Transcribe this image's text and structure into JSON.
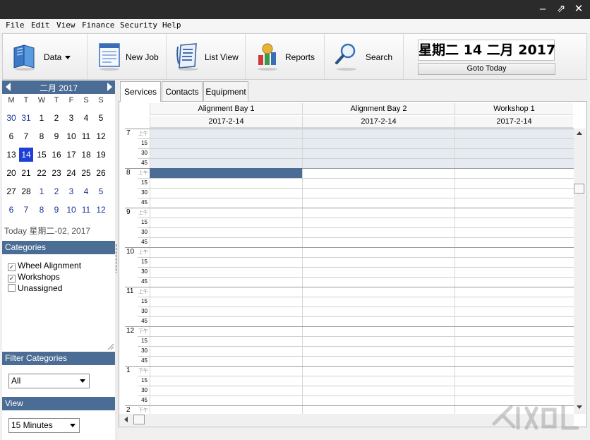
{
  "window": {
    "minimize_glyph": "‒",
    "maximize_glyph": "⇗",
    "close_glyph": "✕"
  },
  "menu": [
    "File",
    "Edit",
    "View",
    "Finance",
    "Security",
    "Help"
  ],
  "toolbar": {
    "data_label": "Data",
    "new_job_label": "New Job",
    "list_view_label": "List View",
    "reports_label": "Reports",
    "search_label": "Search",
    "date_display": "星期二 14 二月 2017",
    "goto_today_label": "Goto Today",
    "icons": [
      "book-icon",
      "new-job-icon",
      "list-view-icon",
      "reports-icon",
      "magnifier-icon"
    ]
  },
  "calendar": {
    "month_title": "二月 2017",
    "day_headers": [
      "M",
      "T",
      "W",
      "T",
      "F",
      "S",
      "S"
    ],
    "weeks": [
      [
        "30",
        "31",
        "1",
        "2",
        "3",
        "4",
        "5"
      ],
      [
        "6",
        "7",
        "8",
        "9",
        "10",
        "11",
        "12"
      ],
      [
        "13",
        "14",
        "15",
        "16",
        "17",
        "18",
        "19"
      ],
      [
        "20",
        "21",
        "22",
        "23",
        "24",
        "25",
        "26"
      ],
      [
        "27",
        "28",
        "1",
        "2",
        "3",
        "4",
        "5"
      ],
      [
        "6",
        "7",
        "8",
        "9",
        "10",
        "11",
        "12"
      ]
    ],
    "selected_day": "14",
    "today_text": "Today 星期二-02, 2017"
  },
  "categories": {
    "title": "Categories",
    "items": [
      {
        "label": "Wheel Alignment",
        "checked": true
      },
      {
        "label": "Workshops",
        "checked": true
      },
      {
        "label": "Unassigned",
        "checked": false
      }
    ]
  },
  "filter": {
    "title": "Filter Categories",
    "value": "All"
  },
  "view": {
    "title": "View",
    "value": "15 Minutes"
  },
  "tabs": [
    "Services",
    "Contacts",
    "Equipment"
  ],
  "active_tab": "Services",
  "schedule": {
    "columns": [
      {
        "name": "Alignment Bay 1",
        "date": "2017-2-14"
      },
      {
        "name": "Alignment Bay 2",
        "date": "2017-2-14"
      },
      {
        "name": "Workshop 1",
        "date": "2017-2-14"
      }
    ],
    "hours": [
      {
        "label": "7",
        "ampm": "上午"
      },
      {
        "label": "8",
        "ampm": "上午"
      },
      {
        "label": "9",
        "ampm": "上午"
      },
      {
        "label": "10",
        "ampm": "上午"
      },
      {
        "label": "11",
        "ampm": "上午"
      },
      {
        "label": "12",
        "ampm": "下午"
      },
      {
        "label": "1",
        "ampm": "下午"
      },
      {
        "label": "2",
        "ampm": "下午"
      }
    ],
    "minute_labels": [
      "15",
      "30",
      "45"
    ]
  },
  "colors": {
    "header_blue": "#4a6c95",
    "selected_day": "#1f3fd6",
    "event_fill": "#4a6c95",
    "off_hours_fill": "#e6ebf2"
  }
}
